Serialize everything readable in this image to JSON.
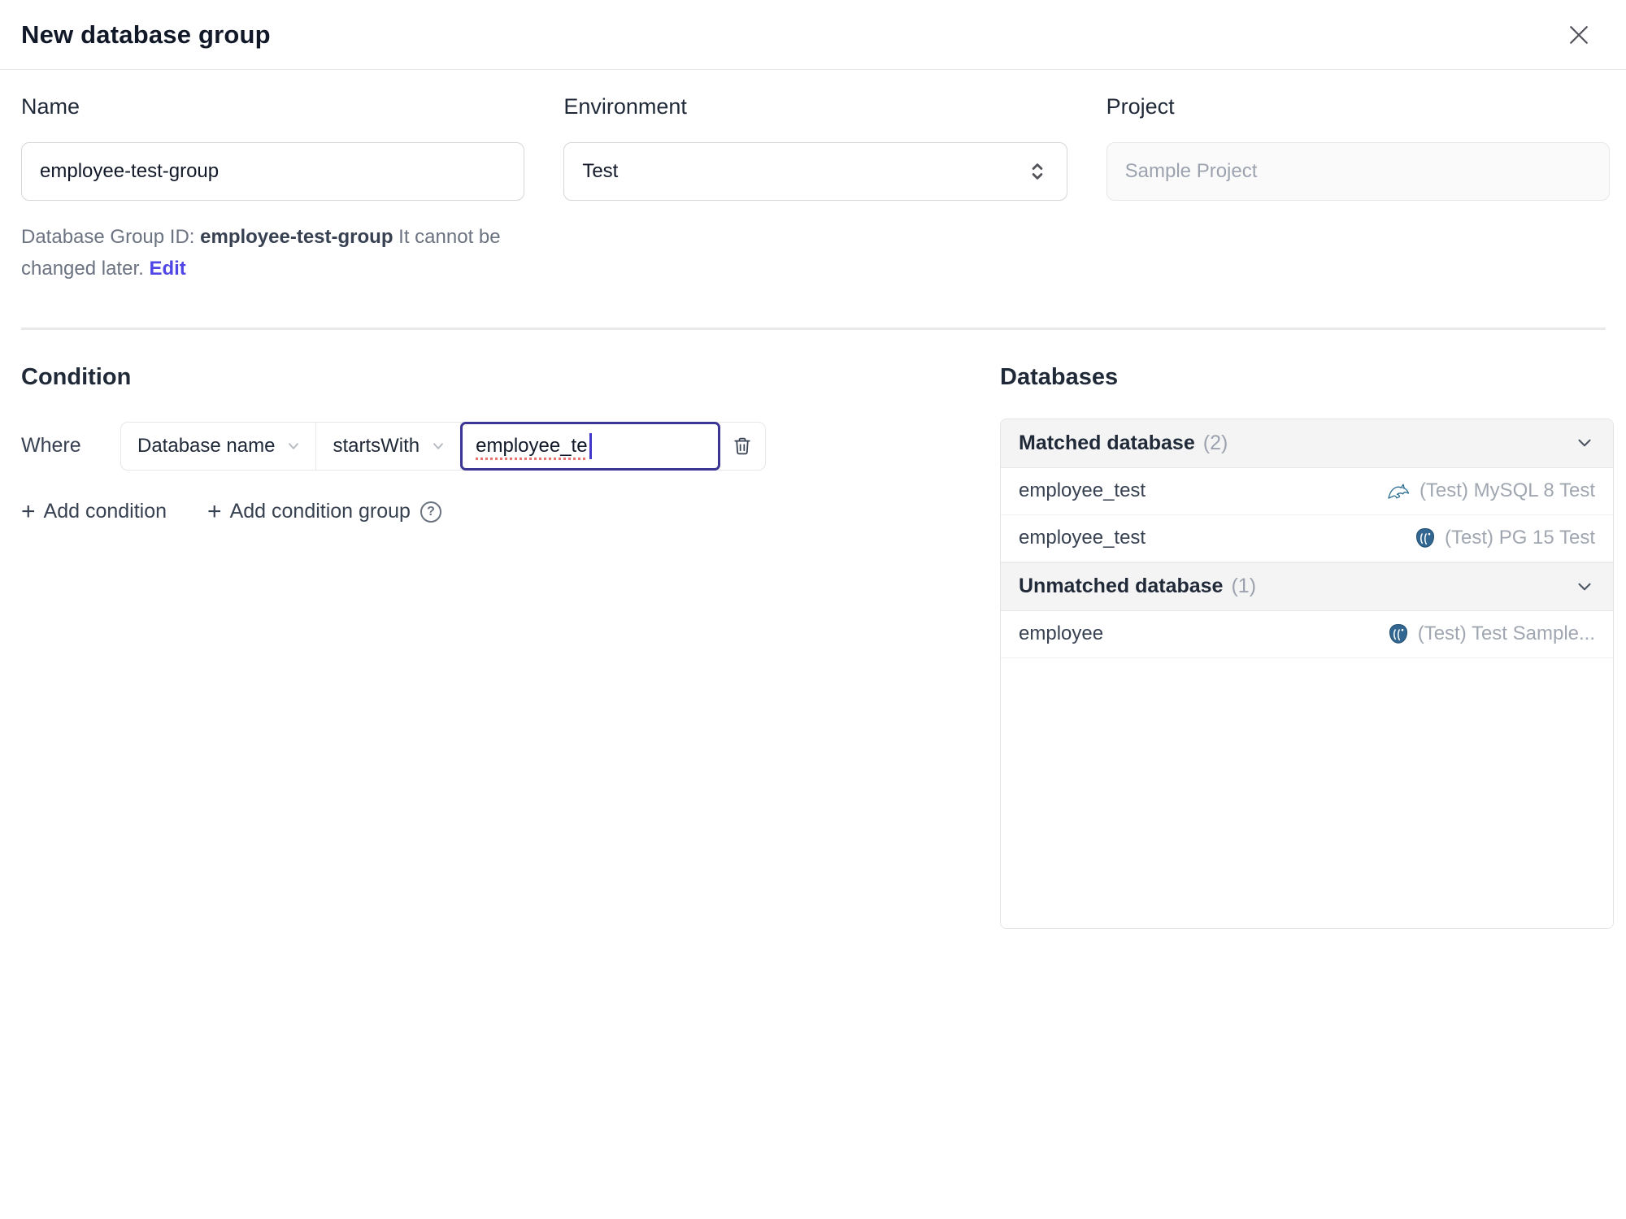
{
  "dialog": {
    "title": "New database group"
  },
  "form": {
    "name": {
      "label": "Name",
      "value": "employee-test-group"
    },
    "environment": {
      "label": "Environment",
      "value": "Test"
    },
    "project": {
      "label": "Project",
      "value": "Sample Project"
    },
    "group_id_help": {
      "prefix": "Database Group ID: ",
      "id": "employee-test-group",
      "suffix": " It cannot be changed later. ",
      "edit_label": "Edit"
    }
  },
  "condition": {
    "heading": "Condition",
    "where_label": "Where",
    "field": "Database name",
    "operator": "startsWith",
    "value": "employee_te",
    "add_condition_label": "Add condition",
    "add_condition_group_label": "Add condition group",
    "help_glyph": "?"
  },
  "databases": {
    "heading": "Databases",
    "sections": [
      {
        "title": "Matched database",
        "count": "(2)",
        "rows": [
          {
            "name": "employee_test",
            "engine": "mysql",
            "instance": "(Test) MySQL 8 Test"
          },
          {
            "name": "employee_test",
            "engine": "postgres",
            "instance": "(Test) PG 15 Test"
          }
        ]
      },
      {
        "title": "Unmatched database",
        "count": "(1)",
        "rows": [
          {
            "name": "employee",
            "engine": "postgres",
            "instance": "(Test) Test Sample..."
          }
        ]
      }
    ]
  },
  "colors": {
    "accent": "#4f46e5",
    "focus_border": "#3b3694",
    "spellcheck_underline": "#e8746f",
    "mysql_icon": "#2c6e91",
    "postgres_icon": "#336791",
    "muted_text": "#9ca3af",
    "header_bg": "#f4f4f5",
    "border": "#e4e4e7"
  }
}
